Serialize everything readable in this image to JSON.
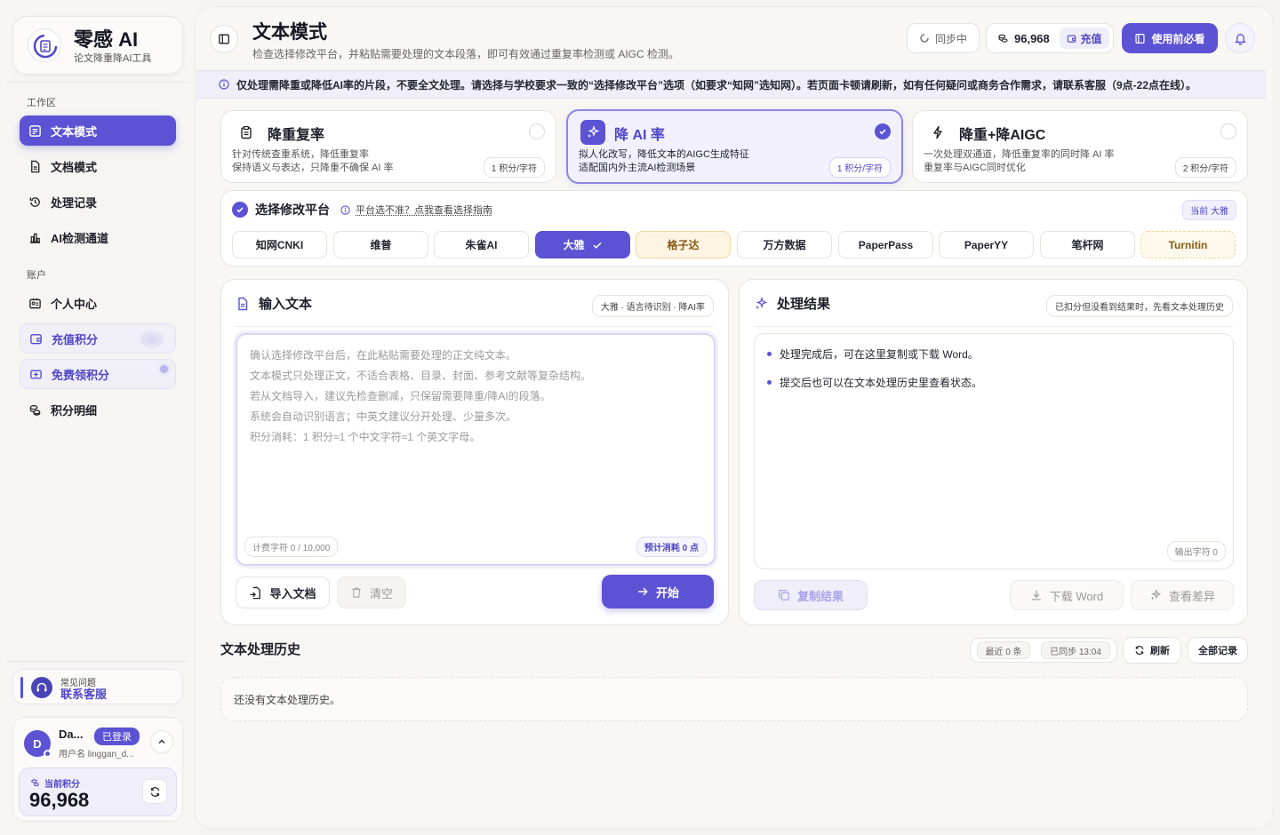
{
  "brand": {
    "name": "零感 AI",
    "tagline": "论文降重降AI工具"
  },
  "sidebar": {
    "section_work": "工作区",
    "work_items": [
      {
        "label": "文本模式",
        "icon": "text-mode-icon",
        "active": true
      },
      {
        "label": "文档模式",
        "icon": "document-icon"
      },
      {
        "label": "处理记录",
        "icon": "history-icon"
      },
      {
        "label": "AI检测通道",
        "icon": "chart-icon"
      }
    ],
    "section_account": "账户",
    "account_items": [
      {
        "label": "个人中心",
        "icon": "id-card-icon"
      },
      {
        "label": "充值积分",
        "icon": "wallet-icon"
      },
      {
        "label": "免费领积分",
        "icon": "ticket-icon"
      },
      {
        "label": "积分明细",
        "icon": "coins-icon"
      }
    ],
    "help": {
      "line1": "常见问题",
      "line2": "联系客服"
    },
    "user": {
      "avatar_letter": "D",
      "name": "Da...",
      "status": "已登录",
      "handle": "用户名 linggan_d...",
      "points_label": "当前积分",
      "points_value": "96,968"
    }
  },
  "header": {
    "title": "文本模式",
    "subtitle": "检查选择修改平台，并粘贴需要处理的文本段落，即可有效通过重复率检测或 AIGC 检测。",
    "sync_label": "同步中",
    "balance": "96,968",
    "recharge_label": "充值",
    "guide_label": "使用前必看"
  },
  "notice": "仅处理需降重或降低AI率的片段，不要全文处理。请选择与学校要求一致的“选择修改平台”选项（如要求“知网”选知网）。若页面卡顿请刷新，如有任何疑问或商务合作需求，请联系客服（9点-22点在线）。",
  "modes": [
    {
      "title": "降重复率",
      "desc1": "针对传统查重系统，降低重复率",
      "desc2": "保持语义与表达，只降重不确保 AI 率",
      "cost": "1 积分/字符",
      "selected": false
    },
    {
      "title": "降 AI 率",
      "desc1": "拟人化改写，降低文本的AIGC生成特征",
      "desc2": "适配国内外主流AI检测场景",
      "cost": "1 积分/字符",
      "selected": true
    },
    {
      "title": "降重+降AIGC",
      "desc1": "一次处理双通道，降低重复率的同时降 AI 率",
      "desc2": "重复率与AIGC同时优化",
      "cost": "2 积分/字符",
      "selected": false
    }
  ],
  "platform": {
    "title": "选择修改平台",
    "guide": "平台选不准？点我查看选择指南",
    "current": "当前 大雅",
    "options": [
      "知网CNKI",
      "维普",
      "朱雀AI",
      "大雅",
      "格子达",
      "万方数据",
      "PaperPass",
      "PaperYY",
      "笔杆网",
      "Turnitin"
    ],
    "selected": "大雅"
  },
  "input_panel": {
    "title": "输入文本",
    "tag": "大雅 · 语言待识别 · 降AI率",
    "placeholder_lines": [
      "确认选择修改平台后，在此粘贴需要处理的正文纯文本。",
      "文本模式只处理正文，不适合表格、目录、封面、参考文献等复杂结构。",
      "若从文档导入，建议先检查删减，只保留需要降重/降AI的段落。",
      "系统会自动识别语言；中英文建议分开处理、少量多次。",
      "积分消耗：1 积分≈1 个中文字符≈1 个英文字母。"
    ],
    "count": "计费字符 0 / 10,000",
    "estimate": "预计消耗 0 点",
    "import_label": "导入文档",
    "clear_label": "清空",
    "start_label": "开始"
  },
  "result_panel": {
    "title": "处理结果",
    "tag": "已扣分但没看到结果时，先看文本处理历史",
    "bullets": [
      "处理完成后，可在这里复制或下载 Word。",
      "提交后也可以在文本处理历史里查看状态。"
    ],
    "output_count": "输出字符 0",
    "copy_label": "复制结果",
    "download_label": "下载 Word",
    "diff_label": "查看差异"
  },
  "history": {
    "title": "文本处理历史",
    "recent": "最近 0 条",
    "synced": "已同步 13:04",
    "refresh_label": "刷新",
    "all_label": "全部记录",
    "empty": "还没有文本处理历史。"
  },
  "colors": {
    "accent": "#5b52d4",
    "accent_soft": "#f1f0fc",
    "warn_bg": "#fdf4e4",
    "bg": "#f5f4f1"
  }
}
